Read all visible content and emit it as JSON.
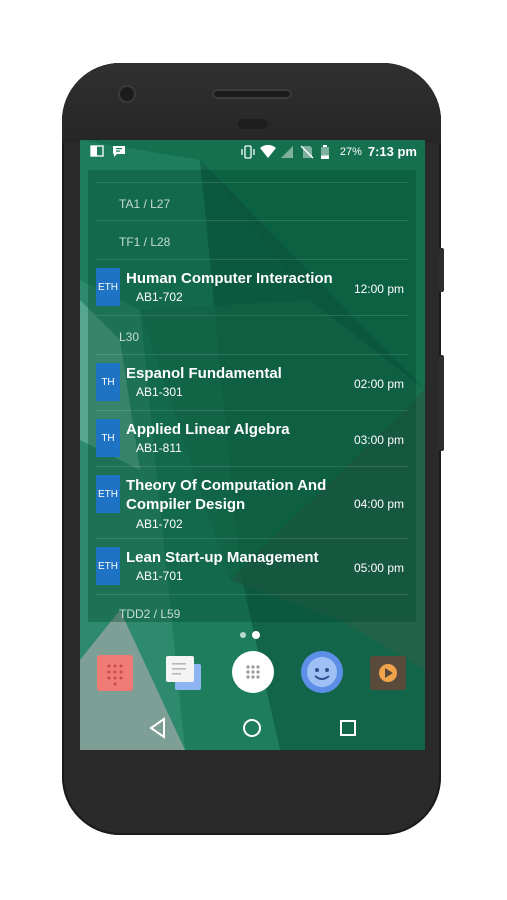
{
  "statusbar": {
    "battery_percent": "27%",
    "time": "7:13 pm",
    "left_icons": [
      "outlook-icon",
      "message-icon"
    ],
    "right_icons": [
      "vibrate-icon",
      "wifi-icon",
      "signal-icon",
      "no-sim-icon",
      "battery-icon"
    ]
  },
  "schedule": {
    "headers": {
      "h1": "TA1 / L27",
      "h2": "TF1 / L28",
      "h3": "L30",
      "h4": "TDD2 / L59"
    },
    "classes": [
      {
        "tag": "ETH",
        "title": "Human Computer Interaction",
        "room": "AB1-702",
        "time": "12:00 pm"
      },
      {
        "tag": "TH",
        "title": "Espanol Fundamental",
        "room": "AB1-301",
        "time": "02:00 pm"
      },
      {
        "tag": "TH",
        "title": "Applied Linear Algebra",
        "room": "AB1-811",
        "time": "03:00 pm"
      },
      {
        "tag": "ETH",
        "title": "Theory Of Computation And Compiler Design",
        "room": "AB1-702",
        "time": "04:00 pm"
      },
      {
        "tag": "ETH",
        "title": "Lean Start-up Management",
        "room": "AB1-701",
        "time": "05:00 pm"
      }
    ]
  },
  "dock": {
    "apps": [
      "dialer-app-icon",
      "messages-app-icon",
      "app-drawer-icon",
      "contacts-app-icon",
      "media-player-app-icon"
    ]
  },
  "navbar": {
    "buttons": [
      "back-icon",
      "home-icon",
      "recents-icon"
    ]
  },
  "colors": {
    "tag_blue": "#1e73c5",
    "wallpaper_green": "#1c7a5a"
  }
}
